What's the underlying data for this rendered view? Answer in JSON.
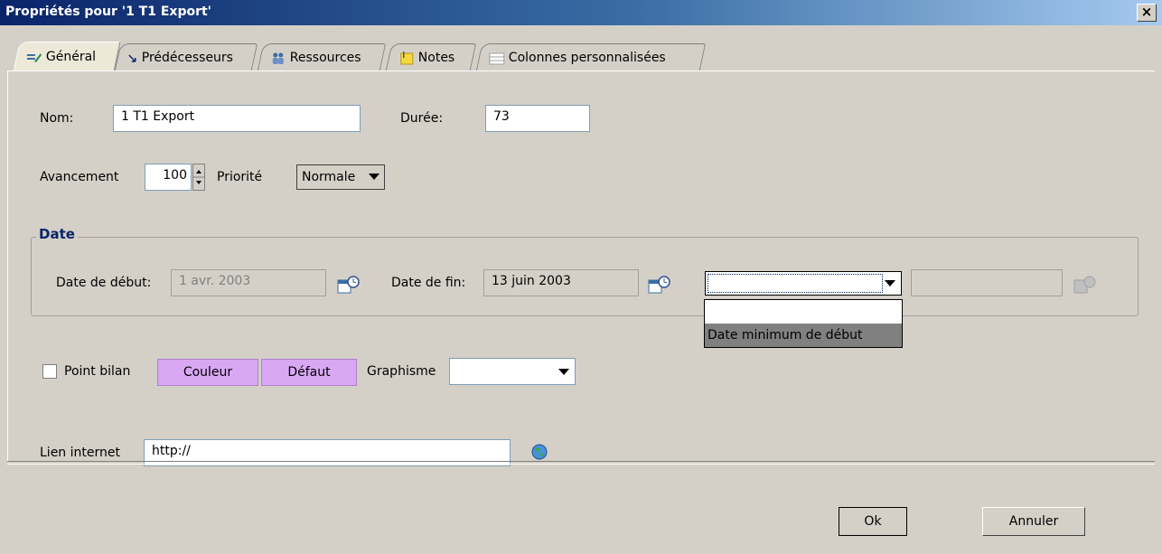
{
  "window": {
    "title": "Propriétés pour '1 T1 Export'",
    "close_label": "×"
  },
  "tabs": [
    {
      "label": "Général",
      "icon": "edit-icon"
    },
    {
      "label": "Prédécesseurs",
      "icon": "arrow-icon"
    },
    {
      "label": "Ressources",
      "icon": "people-icon"
    },
    {
      "label": "Notes",
      "icon": "notes-icon"
    },
    {
      "label": "Colonnes personnalisées",
      "icon": "table-icon"
    }
  ],
  "general": {
    "name_label": "Nom:",
    "name_value": "1 T1 Export",
    "duration_label": "Durée:",
    "duration_value": "73",
    "progress_label": "Avancement",
    "progress_value": "100",
    "priority_label": "Priorité",
    "priority_value": "Normale"
  },
  "date_group": {
    "title": "Date",
    "start_label": "Date de début:",
    "start_value": "1 avr. 2003",
    "end_label": "Date de fin:",
    "end_value": "13 juin 2003",
    "constraint_value": "",
    "dropdown_options": [
      "",
      "Date minimum de début"
    ]
  },
  "display": {
    "milestone_label": "Point bilan",
    "color_button": "Couleur",
    "default_button": "Défaut",
    "shape_label": "Graphisme"
  },
  "link": {
    "label": "Lien internet",
    "value": "http://"
  },
  "footer": {
    "ok_label": "Ok",
    "cancel_label": "Annuler"
  }
}
